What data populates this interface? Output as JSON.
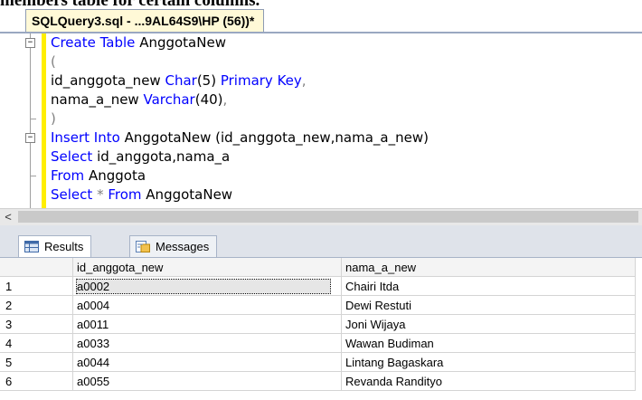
{
  "caption": "members table for certain columns.",
  "editor_tab": {
    "title": "SQLQuery3.sql - ...9AL64S9\\HP (56))*"
  },
  "code": {
    "l1_kw": "Create Table",
    "l1_name": "AnggotaNew",
    "l2": "(",
    "l3_name": "id_anggota_new",
    "l3_kw1": "Char",
    "l3_arg": "(5)",
    "l3_kw2": "Primary Key",
    "l3_end": ",",
    "l4_name": "nama_a_new",
    "l4_kw": "Varchar",
    "l4_arg": "(40)",
    "l4_end": ",",
    "l5": ")",
    "l6_kw": "Insert Into",
    "l6_rest": "AnggotaNew (id_anggota_new,nama_a_new)",
    "l7_kw": "Select",
    "l7_rest": "id_anggota,nama_a",
    "l8_kw": "From",
    "l8_rest": "Anggota",
    "l9_kw1": "Select",
    "l9_star": "*",
    "l9_kw2": "From",
    "l9_rest": "AnggotaNew"
  },
  "scroll_left_arrow": "<",
  "result_tabs": [
    {
      "label": "Results",
      "icon": "grid-icon"
    },
    {
      "label": "Messages",
      "icon": "messages-icon"
    }
  ],
  "grid": {
    "columns": [
      "id_anggota_new",
      "nama_a_new"
    ],
    "rows": [
      {
        "num": "1",
        "id": "a0002",
        "nama": "Chairi Itda"
      },
      {
        "num": "2",
        "id": "a0004",
        "nama": "Dewi Restuti"
      },
      {
        "num": "3",
        "id": "a0011",
        "nama": "Joni Wijaya"
      },
      {
        "num": "4",
        "id": "a0033",
        "nama": "Wawan Budiman"
      },
      {
        "num": "5",
        "id": "a0044",
        "nama": "Lintang Bagaskara"
      },
      {
        "num": "6",
        "id": "a0055",
        "nama": "Revanda Randityo"
      }
    ]
  }
}
